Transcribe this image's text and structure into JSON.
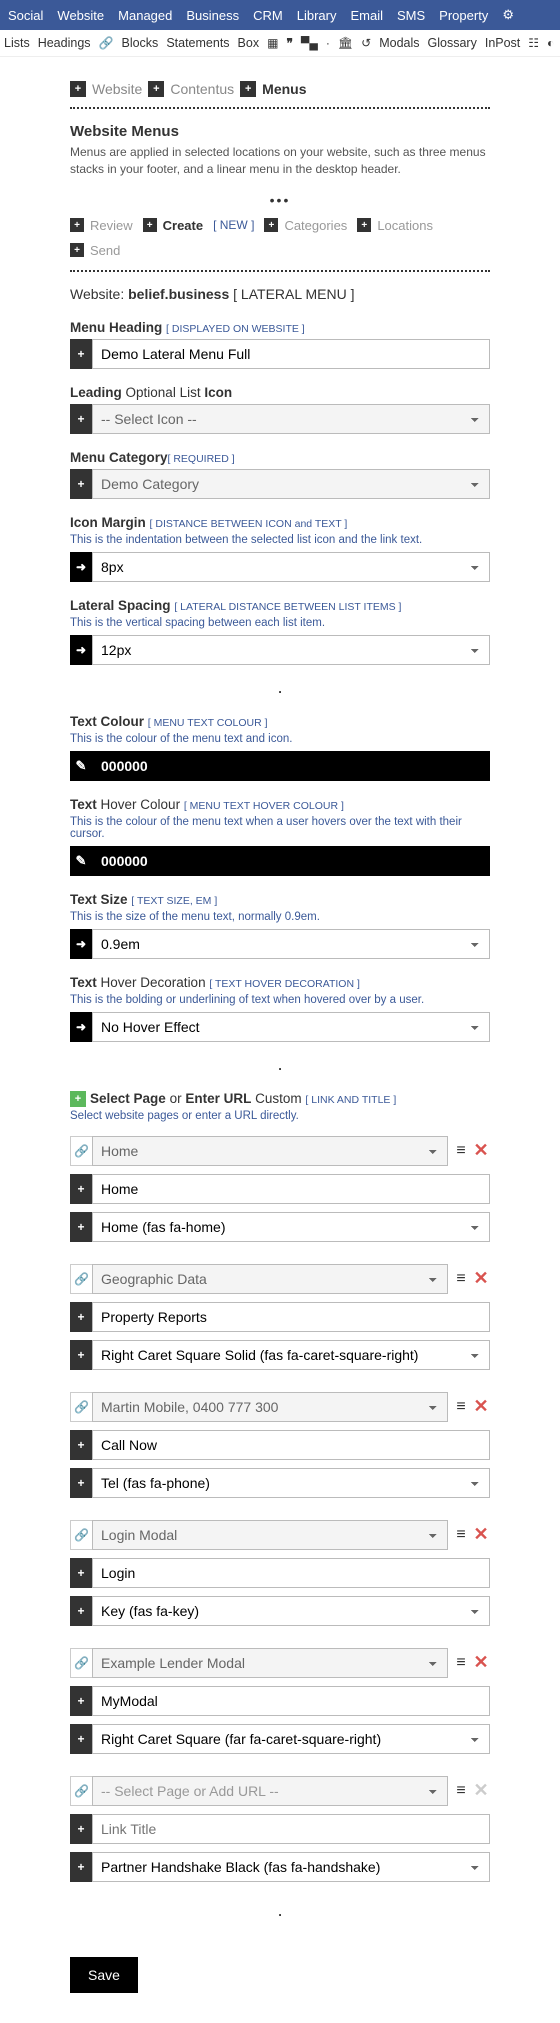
{
  "topNav": [
    "Social",
    "Website",
    "Managed",
    "Business",
    "CRM",
    "Library",
    "Email",
    "SMS",
    "Property"
  ],
  "subNav": {
    "items_left": [
      "Lists",
      "Headings"
    ],
    "items_mid": [
      "Blocks",
      "Statements",
      "Box"
    ],
    "items_right": [
      "Modals",
      "Glossary",
      "InPost"
    ]
  },
  "breadcrumb": {
    "a": "Website",
    "b": "Contentus",
    "c": "Menus"
  },
  "sectionTitle": "Website Menus",
  "sectionDesc": "Menus are applied in selected locations on your website, such as three menus stacks in your footer, and a linear menu in the desktop header.",
  "actions": {
    "review": "Review",
    "create": "Create",
    "new": "[ NEW ]",
    "categories": "Categories",
    "locations": "Locations",
    "send": "Send"
  },
  "websiteLine": {
    "prefix": "Website:",
    "name": "belief.business",
    "suffix": "[ LATERAL MENU ]"
  },
  "fields": {
    "menuHeading": {
      "label": "Menu Heading",
      "meta": "[ DISPLAYED ON WEBSITE ]",
      "value": "Demo Lateral Menu Full"
    },
    "leadingIcon": {
      "labelA": "Leading",
      "labelB": "Optional List",
      "labelC": "Icon",
      "value": "-- Select Icon --"
    },
    "menuCategory": {
      "label": "Menu Category",
      "meta": "[ REQUIRED ]",
      "value": "Demo Category"
    },
    "iconMargin": {
      "label": "Icon Margin",
      "meta": "[ DISTANCE BETWEEN ICON and TEXT ]",
      "hint": "This is the indentation between the selected list icon and the link text.",
      "value": "8px"
    },
    "lateralSpacing": {
      "label": "Lateral Spacing",
      "meta": "[ LATERAL DISTANCE BETWEEN LIST ITEMS ]",
      "hint": "This is the vertical spacing between each list item.",
      "value": "12px"
    },
    "textColour": {
      "label": "Text Colour",
      "meta": "[ MENU TEXT COLOUR ]",
      "hint": "This is the colour of the menu text and icon.",
      "value": "000000"
    },
    "textHoverColour": {
      "labelA": "Text",
      "labelB": "Hover Colour",
      "meta": "[ MENU TEXT HOVER COLOUR ]",
      "hint": "This is the colour of the menu text when a user hovers over the text with their cursor.",
      "value": "000000"
    },
    "textSize": {
      "label": "Text Size",
      "meta": "[ TEXT SIZE, EM ]",
      "hint": "This is the size of the menu text, normally 0.9em.",
      "value": "0.9em"
    },
    "textHoverDeco": {
      "labelA": "Text",
      "labelB": "Hover Decoration",
      "meta": "[ TEXT HOVER DECORATION ]",
      "hint": "This is the bolding or underlining of text when hovered over by a user.",
      "value": "No Hover Effect"
    }
  },
  "pageSection": {
    "labelA": "Select Page",
    "labelMid": "or",
    "labelB": "Enter URL",
    "labelC": "Custom",
    "meta": "[ LINK AND TITLE ]",
    "hint": "Select website pages or enter a URL directly."
  },
  "pages": [
    {
      "page": "Home",
      "title": "Home",
      "icon": "Home (fas fa-home)"
    },
    {
      "page": "Geographic Data",
      "title": "Property Reports",
      "icon": "Right Caret Square Solid (fas fa-caret-square-right)"
    },
    {
      "page": "Martin Mobile, 0400 777 300",
      "title": "Call Now",
      "icon": "Tel (fas fa-phone)"
    },
    {
      "page": "Login Modal",
      "title": "Login",
      "icon": "Key (fas fa-key)"
    },
    {
      "page": "Example Lender Modal",
      "title": "MyModal",
      "icon": "Right Caret Square (far fa-caret-square-right)"
    }
  ],
  "emptyPage": {
    "pagePlaceholder": "-- Select Page or Add URL --",
    "titlePlaceholder": "Link Title",
    "icon": "Partner Handshake Black (fas fa-handshake)"
  },
  "saveLabel": "Save"
}
